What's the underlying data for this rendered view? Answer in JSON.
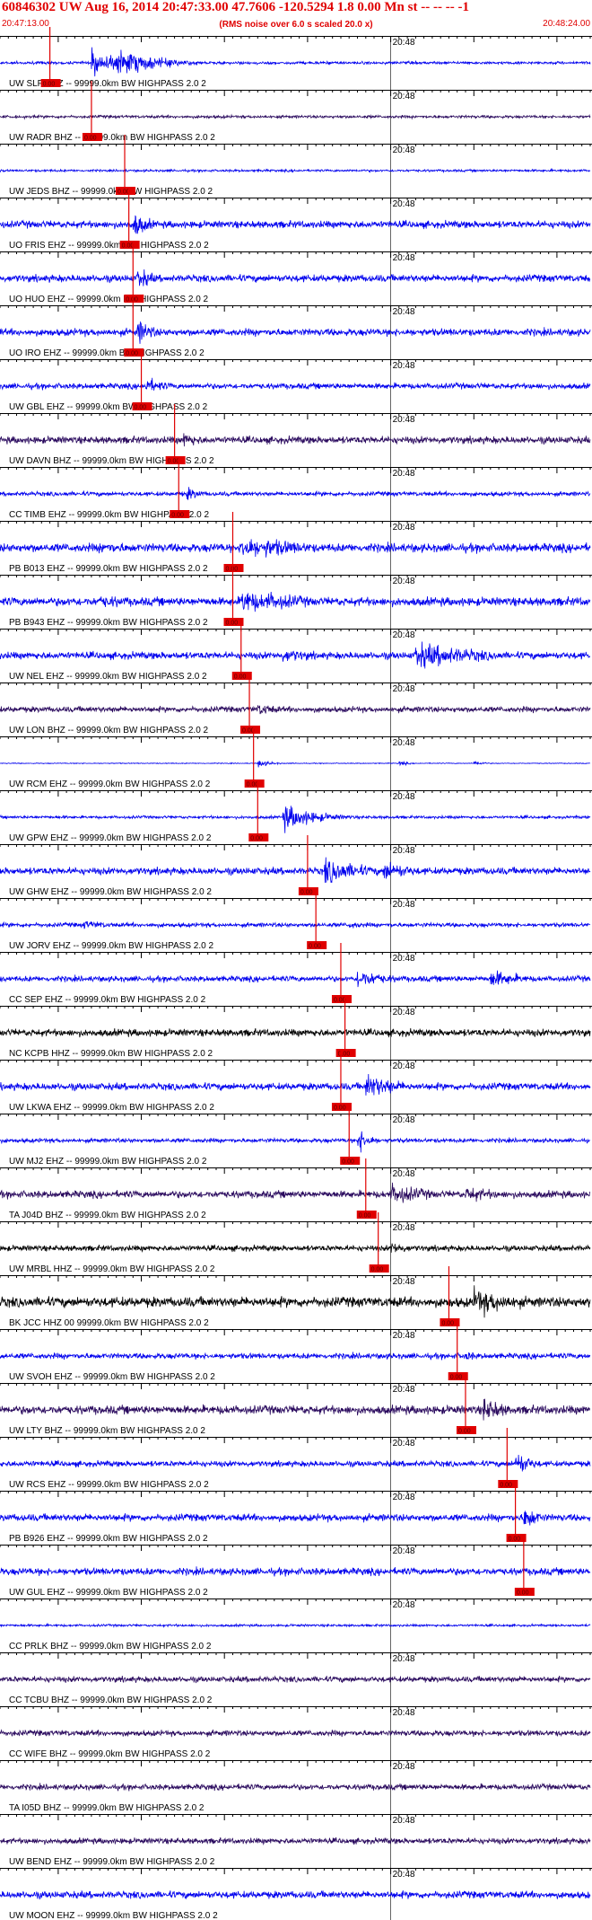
{
  "header": {
    "title": "60846302 UW Aug 16, 2014 20:47:33.00   47.7606 -120.5294  1.8 0.00 Mn st -- -- --  -1",
    "start_time": "20:47:13.00",
    "rms_note": "(RMS noise over 6.0 s scaled 20.0 x)",
    "end_time": "20:48:24.00"
  },
  "colors": {
    "blue": "#0000ee",
    "purple": "#2a0a5e",
    "black": "#000000",
    "pick": "#e00000"
  },
  "chart_data": {
    "type": "line",
    "time_range": [
      "20:47:13.00",
      "20:48:24.00"
    ],
    "time_mark_label": "20:48",
    "time_mark_seconds": 47,
    "total_seconds": 71,
    "pick_label": "0.00",
    "channels": [
      {
        "label": "UW SLF EHZ -- 99999.0km BW  HIGHPASS  2.0  2",
        "pick": 6,
        "color": "blue",
        "noise": 0.1,
        "events": [
          [
            11,
            0.9,
            4
          ],
          [
            14,
            1.0,
            5
          ]
        ]
      },
      {
        "label": "UW RADR BHZ -- 99999.0km BW  HIGHPASS  2.0  2",
        "pick": 11,
        "color": "purple",
        "noise": 0.1,
        "events": []
      },
      {
        "label": "UW JEDS BHZ -- 99999.0km BW  HIGHPASS  2.0  2",
        "pick": 15,
        "color": "blue",
        "noise": 0.08,
        "events": []
      },
      {
        "label": "UO FRIS EHZ -- 99999.0km BW  HIGHPASS  2.0  2",
        "pick": 15.5,
        "color": "blue",
        "noise": 0.25,
        "events": [
          [
            16,
            1.0,
            2
          ]
        ]
      },
      {
        "label": "UO HUO EHZ -- 99999.0km BW  HIGHPASS  2.0  2",
        "pick": 16,
        "color": "blue",
        "noise": 0.25,
        "events": [
          [
            16.5,
            0.9,
            2
          ]
        ]
      },
      {
        "label": "UO IRO EHZ -- 99999.0km BW  HIGHPASS  2.0  2",
        "pick": 16,
        "color": "blue",
        "noise": 0.25,
        "events": [
          [
            16.5,
            1.0,
            2
          ]
        ]
      },
      {
        "label": "UW GBL EHZ -- 99999.0km BW  HIGHPASS  2.0  2",
        "pick": 17,
        "color": "blue",
        "noise": 0.2,
        "events": [
          [
            17.5,
            0.6,
            3
          ]
        ]
      },
      {
        "label": "UW DAVN BHZ -- 99999.0km BW  HIGHPASS  2.0  2",
        "pick": 21,
        "color": "purple",
        "noise": 0.25,
        "events": [
          [
            22,
            0.6,
            3
          ]
        ]
      },
      {
        "label": "CC TIMB EHZ -- 99999.0km BW  HIGHPASS  2.0  2",
        "pick": 21.5,
        "color": "blue",
        "noise": 0.15,
        "events": [
          [
            22.5,
            0.5,
            2
          ]
        ]
      },
      {
        "label": "PB B013 EHZ -- 99999.0km BW  HIGHPASS  2.0  2",
        "pick": 28,
        "color": "blue",
        "noise": 0.3,
        "events": [
          [
            12,
            0.45,
            10
          ],
          [
            29,
            1.0,
            4
          ],
          [
            32,
            0.7,
            7
          ]
        ]
      },
      {
        "label": "PB B943 EHZ -- 99999.0km BW  HIGHPASS  2.0  2",
        "pick": 28,
        "color": "blue",
        "noise": 0.3,
        "events": [
          [
            12,
            0.45,
            10
          ],
          [
            29,
            1.0,
            4
          ],
          [
            32,
            0.7,
            7
          ]
        ]
      },
      {
        "label": "UW NEL EHZ -- 99999.0km BW  HIGHPASS  2.0  2",
        "pick": 29,
        "color": "blue",
        "noise": 0.25,
        "events": [
          [
            34,
            0.5,
            6
          ],
          [
            50,
            1.0,
            8
          ]
        ]
      },
      {
        "label": "UW LON BHZ -- 99999.0km BW  HIGHPASS  2.0  2",
        "pick": 30,
        "color": "purple",
        "noise": 0.2,
        "events": [
          [
            31,
            0.5,
            3
          ]
        ]
      },
      {
        "label": "UW RCM EHZ -- 99999.0km BW  HIGHPASS  2.0  2",
        "pick": 30.5,
        "color": "blue",
        "noise": 0.03,
        "events": [
          [
            31,
            0.3,
            1.5
          ],
          [
            48,
            0.2,
            1
          ],
          [
            57,
            0.25,
            1
          ]
        ]
      },
      {
        "label": "UW GPW EHZ -- 99999.0km BW  HIGHPASS  2.0  2",
        "pick": 31,
        "color": "blue",
        "noise": 0.1,
        "events": [
          [
            34,
            1.0,
            4
          ]
        ]
      },
      {
        "label": "UW GHW EHZ -- 99999.0km BW  HIGHPASS  2.0  2",
        "pick": 37,
        "color": "blue",
        "noise": 0.25,
        "events": [
          [
            39,
            1.0,
            5
          ],
          [
            46,
            0.8,
            4
          ]
        ]
      },
      {
        "label": "UW JORV EHZ -- 99999.0km BW  HIGHPASS  2.0  2",
        "pick": 38,
        "color": "blue",
        "noise": 0.15,
        "events": [
          [
            10,
            0.35,
            4
          ],
          [
            42,
            0.3,
            3
          ]
        ]
      },
      {
        "label": "CC SEP EHZ -- 99999.0km BW  HIGHPASS  2.0  2",
        "pick": 41,
        "color": "blue",
        "noise": 0.2,
        "events": [
          [
            43,
            0.7,
            4
          ],
          [
            59,
            0.7,
            4
          ]
        ]
      },
      {
        "label": "NC KCPB HHZ -- 99999.0km BW  HIGHPASS  2.0  2",
        "pick": 41.5,
        "color": "black",
        "noise": 0.25,
        "events": []
      },
      {
        "label": "UW LKWA EHZ -- 99999.0km BW  HIGHPASS  2.0  2",
        "pick": 41,
        "color": "blue",
        "noise": 0.25,
        "events": [
          [
            44,
            1.0,
            4
          ]
        ]
      },
      {
        "label": "UW MJ2 EHZ -- 99999.0km BW  HIGHPASS  2.0  2",
        "pick": 42,
        "color": "blue",
        "noise": 0.15,
        "events": [
          [
            43,
            1.0,
            1.5
          ]
        ]
      },
      {
        "label": "TA J04D BHZ -- 99999.0km BW  HIGHPASS  2.0  2",
        "pick": 44,
        "color": "purple",
        "noise": 0.25,
        "events": [
          [
            47,
            0.8,
            5
          ],
          [
            56,
            0.6,
            5
          ]
        ]
      },
      {
        "label": "UW MRBL HHZ -- 99999.0km BW  HIGHPASS  2.0  2",
        "pick": 45.5,
        "color": "black",
        "noise": 0.2,
        "events": [
          [
            47,
            0.5,
            3
          ]
        ]
      },
      {
        "label": "BK JCC HHZ 00 99999.0km BW  HIGHPASS  2.0  2",
        "pick": 54,
        "color": "black",
        "noise": 0.35,
        "events": [
          [
            57,
            1.0,
            6
          ]
        ]
      },
      {
        "label": "UW SVOH EHZ -- 99999.0km BW  HIGHPASS  2.0  2",
        "pick": 55,
        "color": "blue",
        "noise": 0.2,
        "events": [
          [
            56,
            0.4,
            2
          ]
        ]
      },
      {
        "label": "UW LTY BHZ -- 99999.0km BW  HIGHPASS  2.0  2",
        "pick": 56,
        "color": "purple",
        "noise": 0.3,
        "events": [
          [
            58,
            1.0,
            3
          ]
        ]
      },
      {
        "label": "UW RCS EHZ -- 99999.0km BW  HIGHPASS  2.0  2",
        "pick": 61,
        "color": "blue",
        "noise": 0.2,
        "events": [
          [
            62,
            1.0,
            2
          ]
        ]
      },
      {
        "label": "PB B926 EHZ -- 99999.0km BW  HIGHPASS  2.0  2",
        "pick": 62,
        "color": "blue",
        "noise": 0.25,
        "events": [
          [
            63,
            1.0,
            2
          ]
        ]
      },
      {
        "label": "UW GUL EHZ -- 99999.0km BW  HIGHPASS  2.0  2",
        "pick": 63,
        "color": "blue",
        "noise": 0.25,
        "events": []
      },
      {
        "label": "CC PRLK BHZ -- 99999.0km BW  HIGHPASS  2.0  2",
        "pick": null,
        "color": "blue",
        "noise": 0.08,
        "events": []
      },
      {
        "label": "CC TCBU BHZ -- 99999.0km BW  HIGHPASS  2.0  2",
        "pick": null,
        "color": "purple",
        "noise": 0.2,
        "events": []
      },
      {
        "label": "CC WIFE BHZ -- 99999.0km BW  HIGHPASS  2.0  2",
        "pick": null,
        "color": "purple",
        "noise": 0.2,
        "events": []
      },
      {
        "label": "TA I05D BHZ -- 99999.0km BW  HIGHPASS  2.0  2",
        "pick": null,
        "color": "purple",
        "noise": 0.2,
        "events": []
      },
      {
        "label": "UW BEND EHZ -- 99999.0km BW  HIGHPASS  2.0  2",
        "pick": null,
        "color": "purple",
        "noise": 0.2,
        "events": []
      },
      {
        "label": "UW MOON EHZ -- 99999.0km BW  HIGHPASS  2.0  2",
        "pick": null,
        "color": "blue",
        "noise": 0.25,
        "events": []
      }
    ]
  }
}
